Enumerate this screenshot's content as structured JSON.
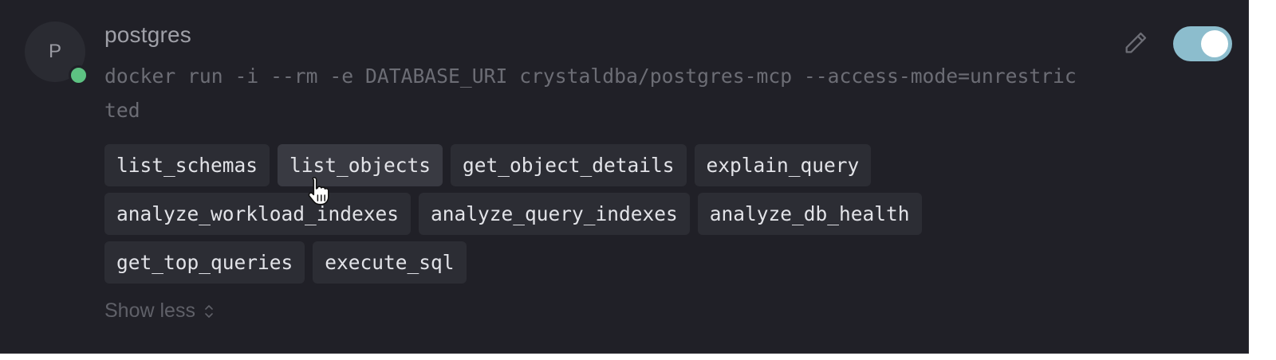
{
  "server": {
    "avatar_letter": "P",
    "name": "postgres",
    "status": "connected",
    "status_color": "#5dc282",
    "command": "docker run -i --rm -e DATABASE_URI crystaldba/postgres-mcp --access-mode=unrestricted"
  },
  "actions": {
    "edit_icon": "pencil-icon",
    "toggle_enabled": true,
    "toggle_color": "#8cbdcd"
  },
  "tools": [
    [
      "list_schemas",
      "list_objects",
      "get_object_details",
      "explain_query"
    ],
    [
      "analyze_workload_indexes",
      "analyze_query_indexes",
      "analyze_db_health"
    ],
    [
      "get_top_queries",
      "execute_sql"
    ]
  ],
  "hovered_tool": "list_objects",
  "show_less": {
    "label": "Show less",
    "icon": "chevron-up-down-icon"
  }
}
